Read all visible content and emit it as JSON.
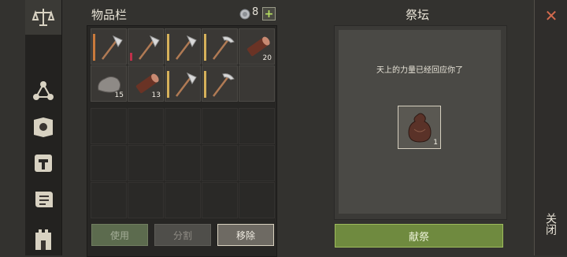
{
  "inventory": {
    "title": "物品栏",
    "currency_count": "8",
    "add_symbol": "+",
    "items": [
      {
        "icon": "axe-icon",
        "qty": "",
        "bar_color": "#c97a3c"
      },
      {
        "icon": "pickaxe-icon",
        "qty": "",
        "bar_color": "#c0304a"
      },
      {
        "icon": "axe-icon",
        "qty": "",
        "bar_color": "#d6b15a"
      },
      {
        "icon": "pickaxe-icon",
        "qty": "",
        "bar_color": "#d6b15a"
      },
      {
        "icon": "log-icon",
        "qty": "20",
        "bar_color": ""
      },
      {
        "icon": "stone-icon",
        "qty": "15",
        "bar_color": ""
      },
      {
        "icon": "log-icon",
        "qty": "13",
        "bar_color": ""
      },
      {
        "icon": "axe-icon",
        "qty": "",
        "bar_color": "#d6b15a"
      },
      {
        "icon": "pickaxe-icon",
        "qty": "",
        "bar_color": "#d6b15a"
      }
    ],
    "buttons": {
      "use": "使用",
      "split": "分割",
      "remove": "移除"
    }
  },
  "altar": {
    "title": "祭坛",
    "message": "天上的力量已经回应你了",
    "slot_qty": "1",
    "sacrifice_button": "献祭"
  },
  "close": {
    "label": "关闭",
    "x_symbol": "✕"
  },
  "rail": {
    "icons": [
      "balance-scale-icon",
      "network-icon",
      "sun-book-icon",
      "hammer-icon",
      "scroll-icon",
      "fortress-icon"
    ]
  }
}
